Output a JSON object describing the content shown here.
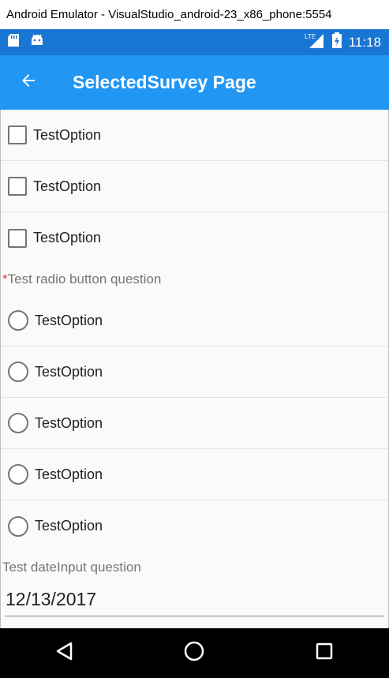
{
  "window": {
    "title": "Android Emulator - VisualStudio_android-23_x86_phone:5554"
  },
  "statusbar": {
    "left_icons": [
      "sd-card-icon",
      "android-icon"
    ],
    "lte_label": "LTE",
    "time": "11:18"
  },
  "appbar": {
    "title": "SelectedSurvey Page"
  },
  "checkbox_options": [
    {
      "label": "TestOption",
      "checked": false
    },
    {
      "label": "TestOption",
      "checked": false
    },
    {
      "label": "TestOption",
      "checked": false
    }
  ],
  "radio_question": {
    "required_mark": "*",
    "text": "Test radio button question"
  },
  "radio_options": [
    {
      "label": "TestOption",
      "selected": false
    },
    {
      "label": "TestOption",
      "selected": false
    },
    {
      "label": "TestOption",
      "selected": false
    },
    {
      "label": "TestOption",
      "selected": false
    },
    {
      "label": "TestOption",
      "selected": false
    }
  ],
  "date_question": {
    "text": "Test dateInput question",
    "value": "12/13/2017"
  },
  "colors": {
    "statusbar": "#1976d2",
    "appbar": "#2196f3",
    "required": "#e53935"
  }
}
